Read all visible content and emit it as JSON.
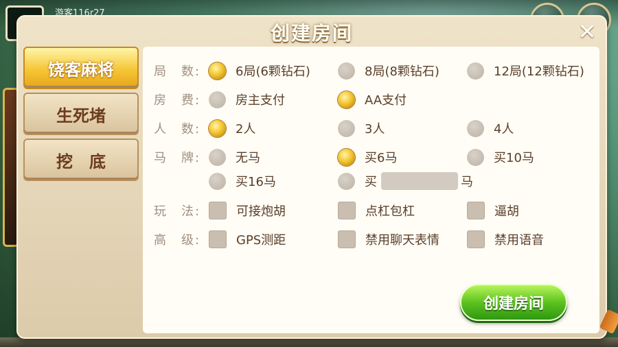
{
  "top_bar": {
    "guest_label": "游客116r27"
  },
  "dialog": {
    "title": "创建房间",
    "close_label": "✕"
  },
  "tabs": [
    {
      "label": "饶客麻将",
      "active": true
    },
    {
      "label": "生死堵",
      "active": false
    },
    {
      "label": "挖　底",
      "active": false
    }
  ],
  "form": {
    "rounds": {
      "label": "局　数:",
      "options": [
        {
          "label": "6局(6颗钻石)",
          "selected": true
        },
        {
          "label": "8局(8颗钻石)",
          "selected": false
        },
        {
          "label": "12局(12颗钻石)",
          "selected": false
        }
      ]
    },
    "fee": {
      "label": "房　费:",
      "options": [
        {
          "label": "房主支付",
          "selected": false
        },
        {
          "label": "AA支付",
          "selected": true
        }
      ]
    },
    "players": {
      "label": "人　数:",
      "options": [
        {
          "label": "2人",
          "selected": true
        },
        {
          "label": "3人",
          "selected": false
        },
        {
          "label": "4人",
          "selected": false
        }
      ]
    },
    "horse": {
      "label": "马　牌:",
      "options": [
        {
          "label": "无马",
          "selected": false
        },
        {
          "label": "买6马",
          "selected": true
        },
        {
          "label": "买10马",
          "selected": false
        },
        {
          "label": "买16马",
          "selected": false
        }
      ],
      "custom": {
        "prefix": "买",
        "suffix": "马",
        "value": ""
      }
    },
    "rules": {
      "label": "玩　法:",
      "options": [
        {
          "label": "可接炮胡",
          "checked": false
        },
        {
          "label": "点杠包杠",
          "checked": false
        },
        {
          "label": "逼胡",
          "checked": false
        }
      ]
    },
    "advanced": {
      "label": "高　级:",
      "options": [
        {
          "label": "GPS测距",
          "checked": false
        },
        {
          "label": "禁用聊天表情",
          "checked": false
        },
        {
          "label": "禁用语音",
          "checked": false
        }
      ]
    }
  },
  "create_button": {
    "label": "创建房间"
  },
  "colors": {
    "accent_gold": "#f4c430",
    "button_green": "#5dc21f",
    "panel_bg": "#fffdf6",
    "label_text": "#5a3e28"
  }
}
